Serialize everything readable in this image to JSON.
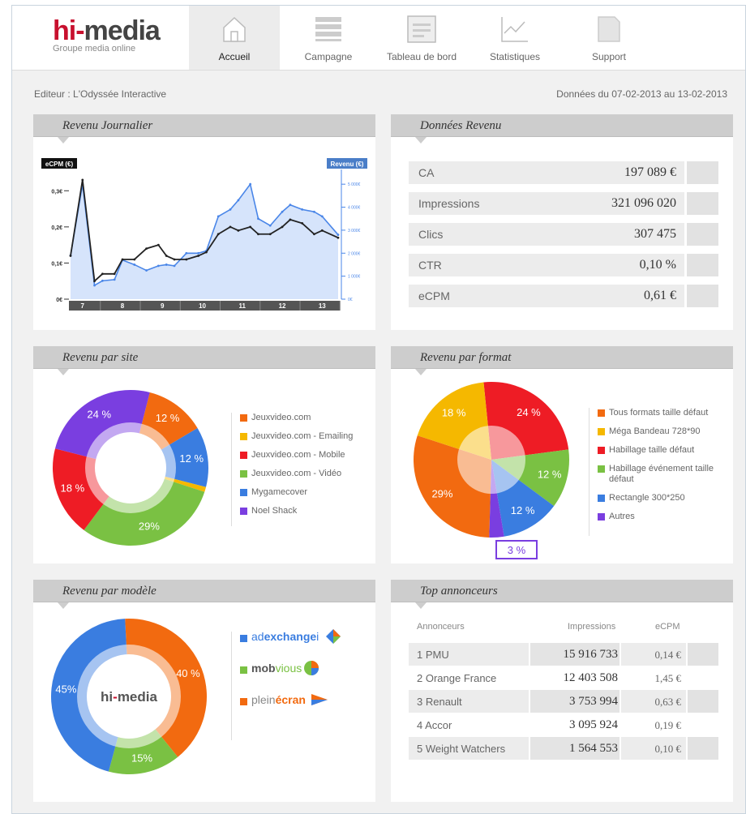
{
  "brand": {
    "logo_hi": "hi",
    "logo_media": "media",
    "tagline": "Groupe media online"
  },
  "nav": [
    {
      "label": "Accueil",
      "icon": "home-icon",
      "active": true
    },
    {
      "label": "Campagne",
      "icon": "list-icon",
      "active": false
    },
    {
      "label": "Tableau de bord",
      "icon": "dashboard-icon",
      "active": false
    },
    {
      "label": "Statistiques",
      "icon": "stats-icon",
      "active": false
    },
    {
      "label": "Support",
      "icon": "document-icon",
      "active": false
    }
  ],
  "meta": {
    "publisher": "Editeur : L'Odyssée Interactive",
    "period": "Données du 07-02-2013 au 13-02-2013"
  },
  "panels": {
    "daily": {
      "title": "Revenu Journalier"
    },
    "data": {
      "title": "Données Revenu"
    },
    "site": {
      "title": "Revenu par site"
    },
    "format": {
      "title": "Revenu par format"
    },
    "model": {
      "title": "Revenu par modèle"
    },
    "top": {
      "title": "Top annonceurs"
    }
  },
  "revenue_data": [
    {
      "label": "CA",
      "value": "197 089 €"
    },
    {
      "label": "Impressions",
      "value": "321 096 020"
    },
    {
      "label": "Clics",
      "value": "307 475"
    },
    {
      "label": "CTR",
      "value": "0,10 %"
    },
    {
      "label": "eCPM",
      "value": "0,61 €"
    }
  ],
  "site_legend": [
    {
      "label": "Jeuxvideo.com",
      "color": "#f26a10"
    },
    {
      "label": "Jeuxvideo.com - Emailing",
      "color": "#f5b800"
    },
    {
      "label": "Jeuxvideo.com - Mobile",
      "color": "#ee1c25"
    },
    {
      "label": "Jeuxvideo.com - Vidéo",
      "color": "#7ac143"
    },
    {
      "label": "Mygamecover",
      "color": "#3a7de0"
    },
    {
      "label": "Noel Shack",
      "color": "#7a3ee0"
    }
  ],
  "format_legend": [
    {
      "label": "Tous formats taille défaut",
      "color": "#f26a10"
    },
    {
      "label": "Méga Bandeau 728*90",
      "color": "#f5b800"
    },
    {
      "label": "Habillage taille défaut",
      "color": "#ee1c25"
    },
    {
      "label": "Habillage événement taille défaut",
      "color": "#7ac143"
    },
    {
      "label": "Rectangle 300*250",
      "color": "#3a7de0"
    },
    {
      "label": "Autres",
      "color": "#7a3ee0"
    }
  ],
  "model_legend": [
    {
      "label_a": "ad",
      "label_b": "exchange",
      "label_c": "i",
      "color": "#3a7de0",
      "sub": ""
    },
    {
      "label_a": "mob",
      "label_b": "vious",
      "label_c": "",
      "color": "#7ac143",
      "sub": ""
    },
    {
      "label_a": "plein",
      "label_b": "écran",
      "label_c": "",
      "color": "#f26a10",
      "sub": ""
    }
  ],
  "model_center": {
    "hi": "hi",
    "media": "media"
  },
  "top_table": {
    "headers": {
      "name": "Annonceurs",
      "imp": "Impressions",
      "ecpm": "eCPM"
    },
    "rows": [
      {
        "name": "1 PMU",
        "imp": "15 916 733",
        "ecpm": "0,14 €"
      },
      {
        "name": "2 Orange France",
        "imp": "12 403 508",
        "ecpm": "1,45 €"
      },
      {
        "name": "3 Renault",
        "imp": "3 753 994",
        "ecpm": "0,63 €"
      },
      {
        "name": "4 Accor",
        "imp": "3 095 924",
        "ecpm": "0,19 €"
      },
      {
        "name": "5 Weight Watchers",
        "imp": "1 564 553",
        "ecpm": "0,10 €"
      }
    ]
  },
  "chart_data": [
    {
      "type": "line",
      "left_axis_label": "eCPM (€)",
      "right_axis_label": "Revenu (€)",
      "yticks_left": [
        "0€",
        "0,1€",
        "0,2€",
        "0,3€"
      ],
      "yticks_right": [
        "0€",
        "1 000€",
        "2 000€",
        "3 000€",
        "4 000€",
        "5 000€"
      ],
      "x_ticks": [
        "7",
        "8",
        "9",
        "10",
        "11",
        "12",
        "13"
      ],
      "ylim_left": [
        0,
        0.35
      ],
      "ylim_right": [
        0,
        5500
      ],
      "series": [
        {
          "axis": "right",
          "color": "#4a86e8",
          "x": [
            6.7,
            7.0,
            7.3,
            7.5,
            7.8,
            8.0,
            8.3,
            8.6,
            8.9,
            9.1,
            9.3,
            9.6,
            9.9,
            10.1,
            10.4,
            10.7,
            10.9,
            11.2,
            11.4,
            11.7,
            12.0,
            12.2,
            12.5,
            12.8,
            13.0,
            13.4
          ],
          "y": [
            1900,
            5000,
            600,
            800,
            850,
            1700,
            1500,
            1250,
            1450,
            1500,
            1450,
            2000,
            2000,
            2100,
            3600,
            3900,
            4300,
            5000,
            3500,
            3200,
            3800,
            4100,
            3900,
            3800,
            3600,
            2800
          ]
        },
        {
          "axis": "left",
          "color": "#222222",
          "x": [
            6.7,
            7.0,
            7.3,
            7.5,
            7.8,
            8.0,
            8.3,
            8.6,
            8.9,
            9.1,
            9.3,
            9.6,
            9.9,
            10.1,
            10.4,
            10.7,
            10.9,
            11.2,
            11.4,
            11.7,
            12.0,
            12.2,
            12.5,
            12.8,
            13.0,
            13.4
          ],
          "y": [
            0.12,
            0.33,
            0.05,
            0.07,
            0.07,
            0.11,
            0.11,
            0.14,
            0.15,
            0.12,
            0.11,
            0.11,
            0.12,
            0.13,
            0.18,
            0.2,
            0.19,
            0.2,
            0.18,
            0.18,
            0.2,
            0.22,
            0.21,
            0.18,
            0.19,
            0.17
          ]
        }
      ]
    },
    {
      "type": "pie",
      "title": "Revenu par site",
      "slices": [
        {
          "label": "Jeuxvideo.com",
          "value": 12,
          "color": "#f26a10",
          "text": "12 %"
        },
        {
          "label": "Mygamecover",
          "value": 12,
          "color": "#3a7de0",
          "text": "12 %"
        },
        {
          "label": "Jeuxvideo.com - Emailing",
          "value": 1,
          "color": "#f5b800",
          "text": ""
        },
        {
          "label": "Jeuxvideo.com - Vidéo",
          "value": 29,
          "color": "#7ac143",
          "text": "29%"
        },
        {
          "label": "Jeuxvideo.com - Mobile",
          "value": 18,
          "color": "#ee1c25",
          "text": "18 %"
        },
        {
          "label": "Noel Shack",
          "value": 24,
          "color": "#7a3ee0",
          "text": "24 %"
        }
      ]
    },
    {
      "type": "pie",
      "title": "Revenu par format",
      "slices": [
        {
          "label": "Habillage taille défaut",
          "value": 24,
          "color": "#ee1c25",
          "text": "24 %"
        },
        {
          "label": "Habillage événement taille défaut",
          "value": 12,
          "color": "#7ac143",
          "text": "12 %"
        },
        {
          "label": "Rectangle 300*250",
          "value": 12,
          "color": "#3a7de0",
          "text": "12 %"
        },
        {
          "label": "Autres",
          "value": 3,
          "color": "#7a3ee0",
          "text": "3 %"
        },
        {
          "label": "Tous formats taille défaut",
          "value": 29,
          "color": "#f26a10",
          "text": "29%"
        },
        {
          "label": "Méga Bandeau 728*90",
          "value": 18,
          "color": "#f5b800",
          "text": "18 %"
        }
      ]
    },
    {
      "type": "pie",
      "title": "Revenu par modèle",
      "slices": [
        {
          "label": "pleinécran",
          "value": 40,
          "color": "#f26a10",
          "text": "40 %"
        },
        {
          "label": "mobvious",
          "value": 15,
          "color": "#7ac143",
          "text": "15%"
        },
        {
          "label": "adexchangei",
          "value": 45,
          "color": "#3a7de0",
          "text": "45%"
        }
      ]
    }
  ]
}
